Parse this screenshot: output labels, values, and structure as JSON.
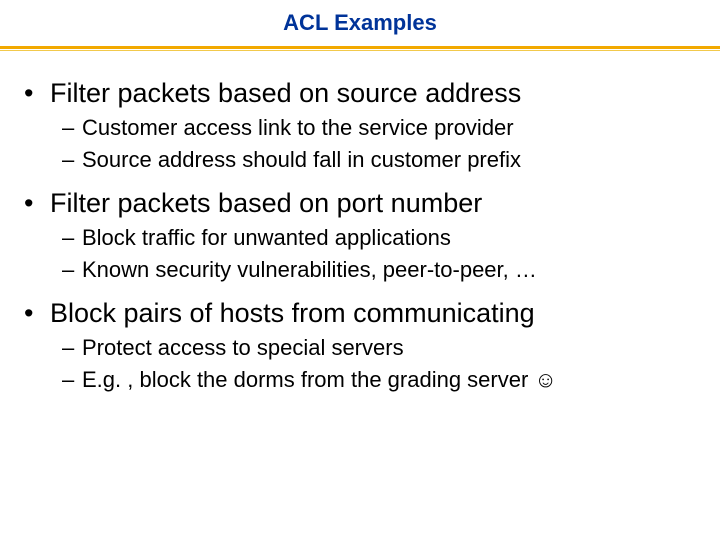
{
  "title": "ACL Examples",
  "bullets": [
    {
      "text": "Filter packets based on source address",
      "subs": [
        "Customer access link to the service provider",
        "Source address should fall in customer prefix"
      ]
    },
    {
      "text": "Filter packets based on port number",
      "subs": [
        "Block traffic for unwanted applications",
        "Known security vulnerabilities, peer-to-peer, …"
      ]
    },
    {
      "text": "Block pairs of hosts from communicating",
      "subs": [
        "Protect access to special servers",
        "E.g. , block the dorms from the grading server ☺"
      ]
    }
  ]
}
